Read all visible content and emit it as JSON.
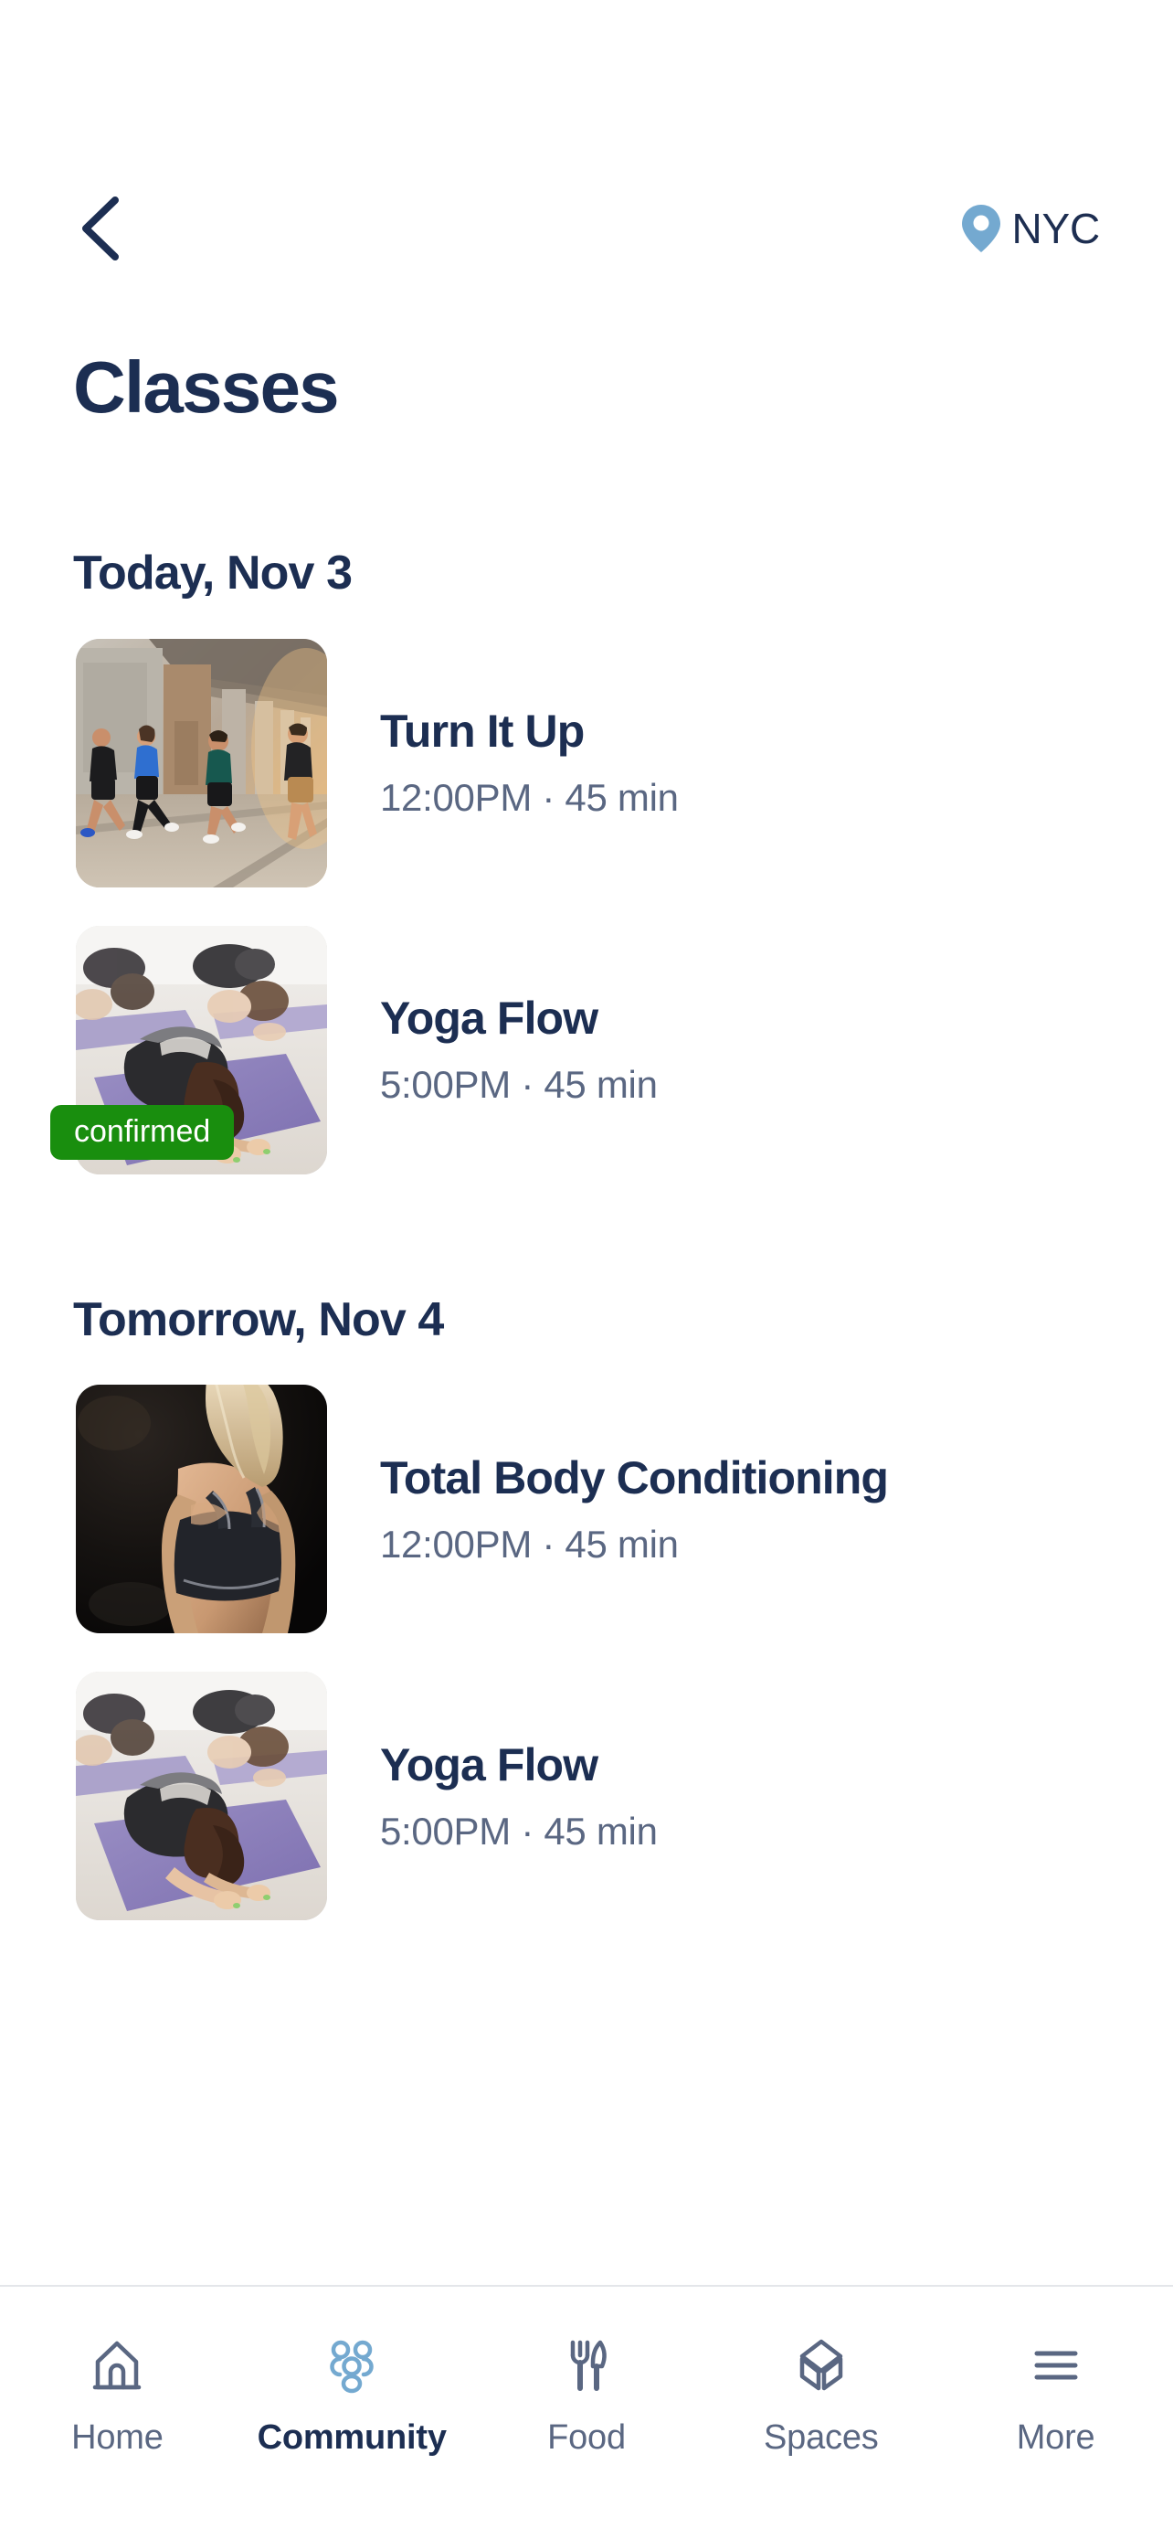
{
  "header": {
    "back_icon": "chevron-left-icon",
    "location_icon": "map-pin-icon",
    "location_label": "NYC"
  },
  "page": {
    "title": "Classes"
  },
  "colors": {
    "navy": "#1c2e52",
    "muted": "#5a6782",
    "accent_blue": "#74a9d0",
    "badge_green": "#198e0e",
    "divider": "#e4e6ea",
    "background": "#ffffff"
  },
  "schedule": [
    {
      "day_label": "Today, Nov 3",
      "classes": [
        {
          "name": "Turn It Up",
          "time": "12:00PM",
          "duration": "45 min",
          "meta": "12:00PM · 45 min",
          "image": "outdoor-group-fitness-under-bridge",
          "badge": null
        },
        {
          "name": "Yoga Flow",
          "time": "5:00PM",
          "duration": "45 min",
          "meta": "5:00PM · 45 min",
          "image": "yoga-class-childs-pose-purple-mats",
          "badge": "confirmed"
        }
      ]
    },
    {
      "day_label": "Tomorrow, Nov 4",
      "classes": [
        {
          "name": "Total Body Conditioning",
          "time": "12:00PM",
          "duration": "45 min",
          "meta": "12:00PM · 45 min",
          "image": "woman-back-sports-bra-dark-gym",
          "badge": null
        },
        {
          "name": "Yoga Flow",
          "time": "5:00PM",
          "duration": "45 min",
          "meta": "5:00PM · 45 min",
          "image": "yoga-class-childs-pose-purple-mats",
          "badge": null
        }
      ]
    }
  ],
  "bottom_nav": {
    "items": [
      {
        "label": "Home",
        "icon": "house-icon",
        "active": false
      },
      {
        "label": "Community",
        "icon": "people-group-icon",
        "active": true
      },
      {
        "label": "Food",
        "icon": "fork-knife-icon",
        "active": false
      },
      {
        "label": "Spaces",
        "icon": "cube-box-icon",
        "active": false
      },
      {
        "label": "More",
        "icon": "hamburger-menu-icon",
        "active": false
      }
    ]
  }
}
